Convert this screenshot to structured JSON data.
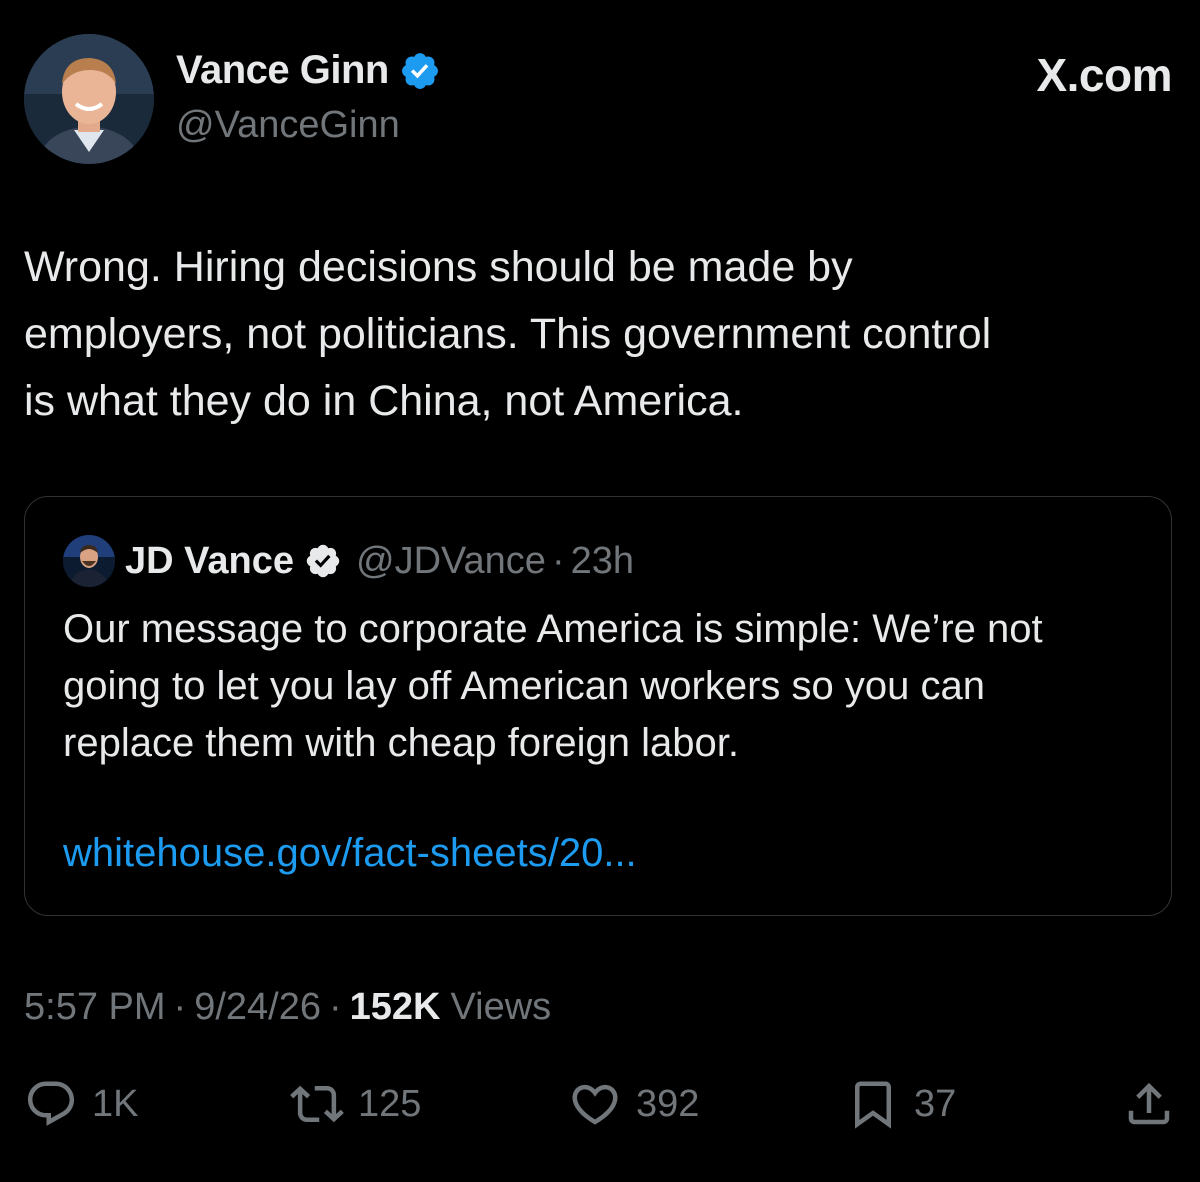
{
  "author": {
    "name": "Vance Ginn",
    "handle": "@VanceGinn"
  },
  "brand": {
    "label": "X.com"
  },
  "tweet": {
    "text": "Wrong. Hiring decisions should be made by\nemployers, not politicians. This government control\nis what they do in China, not America."
  },
  "quoted_tweet": {
    "name": "JD Vance",
    "handle": "@JDVance",
    "separator": "·",
    "time": "23h",
    "text": "Our message to corporate America is simple: We’re not\ngoing to let you lay off American workers so you can\nreplace them with cheap foreign labor.",
    "link": "whitehouse.gov/fact-sheets/20..."
  },
  "meta": {
    "time": "5:57 PM",
    "separator": "·",
    "date": "9/24/26",
    "views_count": "152K",
    "views_label": "Views"
  },
  "actions": {
    "replies": "1K",
    "reposts": "125",
    "likes": "392",
    "bookmarks": "37"
  },
  "icons": {
    "verified": "verified-badge-icon",
    "reply": "reply-icon",
    "repost": "repost-icon",
    "like": "heart-icon",
    "bookmark": "bookmark-icon",
    "share": "share-icon"
  },
  "colors": {
    "background": "#000000",
    "text": "#e7e9ea",
    "muted": "#71767b",
    "link": "#1d9bf0",
    "verified_badge": "#1d9bf0",
    "quote_verified_badge": "#e7e9ea",
    "border": "#2f3336"
  }
}
